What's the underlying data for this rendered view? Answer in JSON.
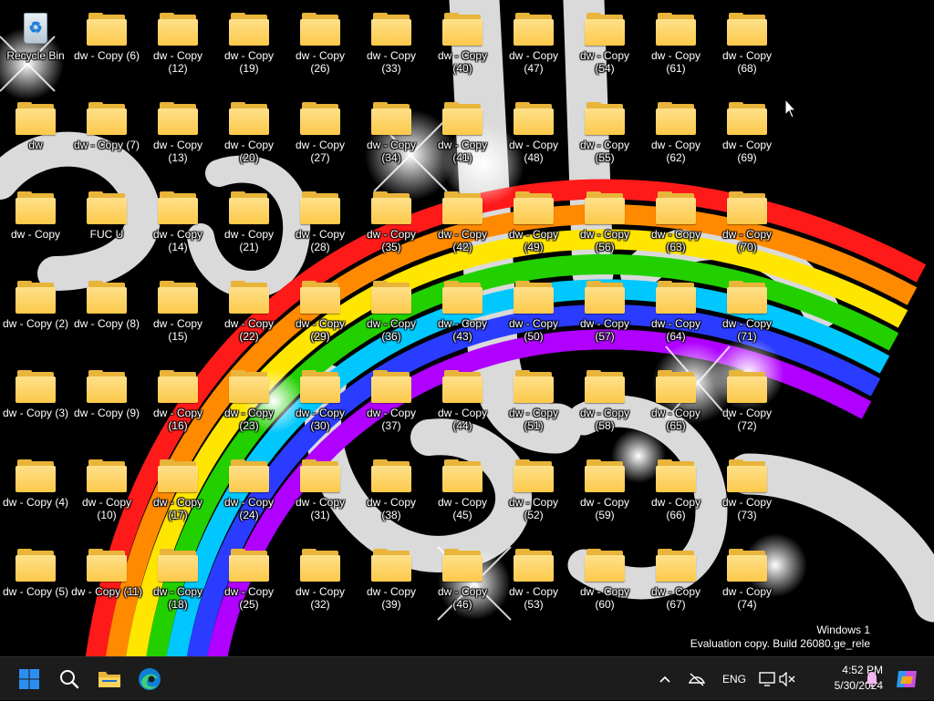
{
  "desktop": {
    "icons": [
      "Recycle Bin",
      "dw - Copy (6)",
      "dw - Copy (12)",
      "dw - Copy (19)",
      "dw - Copy (26)",
      "dw - Copy (33)",
      "dw - Copy (40)",
      "dw - Copy (47)",
      "dw - Copy (54)",
      "dw - Copy (61)",
      "dw - Copy (68)",
      "dw",
      "dw - Copy (7)",
      "dw - Copy (13)",
      "dw - Copy (20)",
      "dw - Copy (27)",
      "dw - Copy (34)",
      "dw - Copy (41)",
      "dw - Copy (48)",
      "dw - Copy (55)",
      "dw - Copy (62)",
      "dw - Copy (69)",
      "dw - Copy",
      "FUC U",
      "dw - Copy (14)",
      "dw - Copy (21)",
      "dw - Copy (28)",
      "dw - Copy (35)",
      "dw - Copy (42)",
      "dw - Copy (49)",
      "dw - Copy (56)",
      "dw - Copy (63)",
      "dw - Copy (70)",
      "dw - Copy (2)",
      "dw - Copy (8)",
      "dw - Copy (15)",
      "dw - Copy (22)",
      "dw - Copy (29)",
      "dw - Copy (36)",
      "dw - Copy (43)",
      "dw - Copy (50)",
      "dw - Copy (57)",
      "dw - Copy (64)",
      "dw - Copy (71)",
      "dw - Copy (3)",
      "dw - Copy (9)",
      "dw - Copy (16)",
      "dw - Copy (23)",
      "dw - Copy (30)",
      "dw - Copy (37)",
      "dw - Copy (44)",
      "dw - Copy (51)",
      "dw - Copy (58)",
      "dw - Copy (65)",
      "dw - Copy (72)",
      "dw - Copy (4)",
      "dw - Copy (10)",
      "dw - Copy (17)",
      "dw - Copy (24)",
      "dw - Copy (31)",
      "dw - Copy (38)",
      "dw - Copy (45)",
      "dw - Copy (52)",
      "dw - Copy (59)",
      "dw - Copy (66)",
      "dw - Copy (73)",
      "dw - Copy (5)",
      "dw - Copy (11)",
      "dw - Copy (18)",
      "dw - Copy (25)",
      "dw - Copy (32)",
      "dw - Copy (39)",
      "dw - Copy (46)",
      "dw - Copy (53)",
      "dw - Copy (60)",
      "dw - Copy (67)",
      "dw - Copy (74)"
    ]
  },
  "watermark": {
    "line1": "Windows 1",
    "line2": "Evaluation copy. Build 26080.ge_rele"
  },
  "taskbar": {
    "language": "ENG",
    "time": "4:52 PM",
    "date": "5/30/2024",
    "icons": [
      "start-icon",
      "search-icon",
      "file-explorer-icon",
      "edge-icon",
      "chevron-up-icon",
      "network-icon",
      "display-icon",
      "volume-muted-icon",
      "notification-bell-icon",
      "copilot-icon"
    ]
  },
  "colors": {
    "taskbar_bg": "#1c1c1c",
    "folder_yellow": "#fcc94a",
    "start_blue": "#2c8ef0"
  }
}
